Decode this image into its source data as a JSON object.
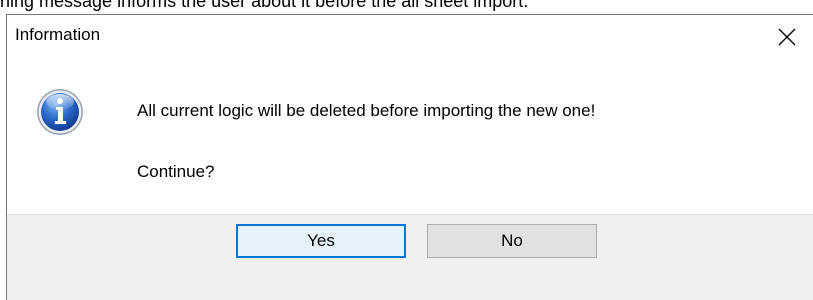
{
  "background_caption": "ning message informs the user about it before the all sheet import.",
  "dialog": {
    "title": "Information",
    "close_icon": "close-icon",
    "icon": "information-icon",
    "message": "All current logic will be deleted before importing the new one!",
    "prompt": "Continue?",
    "buttons": {
      "yes": "Yes",
      "no": "No"
    },
    "default_button": "yes"
  },
  "colors": {
    "accent": "#0078d7",
    "footer_background": "#f0f0f0",
    "button_face": "#e1e1e1",
    "default_button_face": "#e5f1fb",
    "icon_blue": "#1a55b8"
  }
}
